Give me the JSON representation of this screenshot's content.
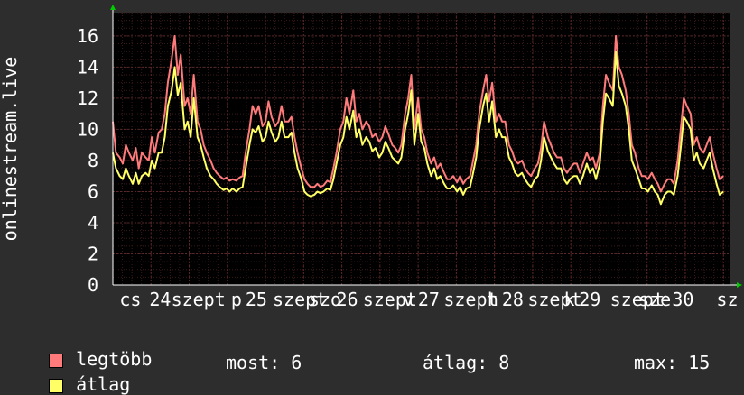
{
  "chart_data": {
    "type": "line",
    "ylabel": "onlinestream.live",
    "ylim": [
      0,
      17.5
    ],
    "yticks": [
      0,
      2,
      4,
      6,
      8,
      10,
      12,
      14,
      16
    ],
    "x_range": [
      0,
      8.08
    ],
    "x_tick_labels": [
      {
        "x": 0.23,
        "label": "cs"
      },
      {
        "x": 0.62,
        "label": "24"
      },
      {
        "x": 1.12,
        "label": "szept"
      },
      {
        "x": 1.62,
        "label": "p"
      },
      {
        "x": 1.88,
        "label": "25"
      },
      {
        "x": 2.45,
        "label": "szept"
      },
      {
        "x": 2.78,
        "label": "szo"
      },
      {
        "x": 3.07,
        "label": "26"
      },
      {
        "x": 3.63,
        "label": "szept"
      },
      {
        "x": 3.87,
        "label": "v"
      },
      {
        "x": 4.14,
        "label": "27"
      },
      {
        "x": 4.69,
        "label": "szept"
      },
      {
        "x": 4.98,
        "label": "h"
      },
      {
        "x": 5.24,
        "label": "28"
      },
      {
        "x": 5.79,
        "label": "szept"
      },
      {
        "x": 5.98,
        "label": "k"
      },
      {
        "x": 6.25,
        "label": "29"
      },
      {
        "x": 6.87,
        "label": "szept"
      },
      {
        "x": 7.1,
        "label": "sze"
      },
      {
        "x": 7.47,
        "label": "30"
      },
      {
        "x": 8.05,
        "label": "sz"
      }
    ],
    "series": [
      {
        "name": "legtöbb",
        "color": "#ff7b7b",
        "x": [
          0,
          0.04,
          0.09,
          0.13,
          0.17,
          0.21,
          0.26,
          0.3,
          0.34,
          0.38,
          0.43,
          0.47,
          0.51,
          0.55,
          0.6,
          0.64,
          0.68,
          0.72,
          0.77,
          0.81,
          0.85,
          0.89,
          0.94,
          0.98,
          1.02,
          1.06,
          1.11,
          1.15,
          1.19,
          1.23,
          1.28,
          1.32,
          1.36,
          1.4,
          1.45,
          1.49,
          1.53,
          1.57,
          1.62,
          1.66,
          1.7,
          1.74,
          1.79,
          1.83,
          1.87,
          1.91,
          1.96,
          2,
          2.04,
          2.08,
          2.13,
          2.17,
          2.21,
          2.25,
          2.3,
          2.34,
          2.38,
          2.42,
          2.47,
          2.51,
          2.55,
          2.59,
          2.64,
          2.68,
          2.72,
          2.76,
          2.81,
          2.85,
          2.89,
          2.93,
          2.98,
          3.02,
          3.06,
          3.1,
          3.15,
          3.19,
          3.23,
          3.27,
          3.32,
          3.36,
          3.4,
          3.44,
          3.49,
          3.53,
          3.57,
          3.61,
          3.66,
          3.7,
          3.74,
          3.78,
          3.83,
          3.87,
          3.91,
          3.95,
          4,
          4.04,
          4.08,
          4.12,
          4.17,
          4.21,
          4.25,
          4.29,
          4.34,
          4.38,
          4.42,
          4.46,
          4.51,
          4.55,
          4.59,
          4.63,
          4.68,
          4.72,
          4.76,
          4.8,
          4.85,
          4.89,
          4.93,
          4.97,
          5.02,
          5.06,
          5.1,
          5.14,
          5.19,
          5.23,
          5.27,
          5.31,
          5.36,
          5.4,
          5.44,
          5.48,
          5.53,
          5.57,
          5.61,
          5.65,
          5.7,
          5.74,
          5.78,
          5.82,
          5.87,
          5.91,
          5.95,
          5.99,
          6.04,
          6.08,
          6.12,
          6.16,
          6.21,
          6.25,
          6.29,
          6.33,
          6.38,
          6.42,
          6.46,
          6.5,
          6.55,
          6.59,
          6.63,
          6.67,
          6.72,
          6.76,
          6.8,
          6.84,
          6.89,
          6.93,
          6.97,
          7.01,
          7.06,
          7.1,
          7.14,
          7.18,
          7.23,
          7.27,
          7.31,
          7.35,
          7.4,
          7.44,
          7.48,
          7.52,
          7.57,
          7.61,
          7.65,
          7.69,
          7.74,
          7.78,
          7.82,
          7.86,
          7.91,
          7.95,
          8
        ],
        "values": [
          10.5,
          8.5,
          8.2,
          7.8,
          9,
          8.5,
          8,
          8.8,
          7.5,
          8.5,
          8.2,
          8,
          9.5,
          8.5,
          9.8,
          10,
          11,
          13,
          14.5,
          16,
          13.5,
          14.8,
          11.5,
          12,
          11,
          13.5,
          10.5,
          10,
          9,
          8.5,
          8,
          7.5,
          7.2,
          7,
          6.8,
          6.9,
          6.7,
          6.8,
          6.7,
          6.9,
          7,
          8.5,
          10,
          11.5,
          11,
          11.5,
          10.2,
          10.5,
          11.8,
          10.8,
          10.2,
          10.5,
          11.5,
          10.5,
          10.5,
          10.8,
          9.5,
          8.5,
          7.5,
          6.8,
          6.5,
          6.3,
          6.3,
          6.5,
          6.3,
          6.4,
          6.7,
          6.6,
          7.5,
          8.5,
          10,
          10.5,
          12,
          11,
          12.5,
          10.5,
          11,
          10,
          10.5,
          10.2,
          9.5,
          9.7,
          9.2,
          9.5,
          10.2,
          9.7,
          9,
          8.8,
          8.5,
          9,
          11,
          12,
          13.5,
          10,
          12,
          10,
          9.5,
          8.5,
          7.8,
          8.2,
          7.5,
          7.8,
          7.2,
          6.8,
          6.8,
          7,
          6.6,
          7,
          6.5,
          6.8,
          7,
          8,
          9,
          11,
          12.5,
          13.5,
          11.8,
          13,
          10.5,
          11,
          10.5,
          10.5,
          9,
          8.6,
          8,
          7.8,
          8,
          7.5,
          7.2,
          7,
          7.5,
          7.8,
          8.8,
          10.5,
          9.5,
          9,
          8.5,
          8.2,
          8.2,
          7.5,
          7.2,
          7.5,
          7.8,
          7.8,
          7.2,
          7.8,
          8.5,
          8,
          8.2,
          7.5,
          8.5,
          11.5,
          13.5,
          13,
          12.5,
          16,
          14,
          13.5,
          12.5,
          11,
          9,
          8.5,
          7.5,
          7,
          7,
          6.8,
          7.2,
          6.8,
          6.5,
          6,
          6.5,
          6.8,
          6.8,
          6.5,
          8,
          10,
          12,
          11.5,
          11,
          9,
          9.5,
          8.8,
          8.5,
          9,
          9.5,
          8.5,
          7.5,
          6.8,
          7
        ]
      },
      {
        "name": "átlag",
        "color": "#ffff66",
        "x": [
          0,
          0.04,
          0.09,
          0.13,
          0.17,
          0.21,
          0.26,
          0.3,
          0.34,
          0.38,
          0.43,
          0.47,
          0.51,
          0.55,
          0.6,
          0.64,
          0.68,
          0.72,
          0.77,
          0.81,
          0.85,
          0.89,
          0.94,
          0.98,
          1.02,
          1.06,
          1.11,
          1.15,
          1.19,
          1.23,
          1.28,
          1.32,
          1.36,
          1.4,
          1.45,
          1.49,
          1.53,
          1.57,
          1.62,
          1.66,
          1.7,
          1.74,
          1.79,
          1.83,
          1.87,
          1.91,
          1.96,
          2,
          2.04,
          2.08,
          2.13,
          2.17,
          2.21,
          2.25,
          2.3,
          2.34,
          2.38,
          2.42,
          2.47,
          2.51,
          2.55,
          2.59,
          2.64,
          2.68,
          2.72,
          2.76,
          2.81,
          2.85,
          2.89,
          2.93,
          2.98,
          3.02,
          3.06,
          3.1,
          3.15,
          3.19,
          3.23,
          3.27,
          3.32,
          3.36,
          3.4,
          3.44,
          3.49,
          3.53,
          3.57,
          3.61,
          3.66,
          3.7,
          3.74,
          3.78,
          3.83,
          3.87,
          3.91,
          3.95,
          4,
          4.04,
          4.08,
          4.12,
          4.17,
          4.21,
          4.25,
          4.29,
          4.34,
          4.38,
          4.42,
          4.46,
          4.51,
          4.55,
          4.59,
          4.63,
          4.68,
          4.72,
          4.76,
          4.8,
          4.85,
          4.89,
          4.93,
          4.97,
          5.02,
          5.06,
          5.1,
          5.14,
          5.19,
          5.23,
          5.27,
          5.31,
          5.36,
          5.4,
          5.44,
          5.48,
          5.53,
          5.57,
          5.61,
          5.65,
          5.7,
          5.74,
          5.78,
          5.82,
          5.87,
          5.91,
          5.95,
          5.99,
          6.04,
          6.08,
          6.12,
          6.16,
          6.21,
          6.25,
          6.29,
          6.33,
          6.38,
          6.42,
          6.46,
          6.5,
          6.55,
          6.59,
          6.63,
          6.67,
          6.72,
          6.76,
          6.8,
          6.84,
          6.89,
          6.93,
          6.97,
          7.01,
          7.06,
          7.1,
          7.14,
          7.18,
          7.23,
          7.27,
          7.31,
          7.35,
          7.4,
          7.44,
          7.48,
          7.52,
          7.57,
          7.61,
          7.65,
          7.69,
          7.74,
          7.78,
          7.82,
          7.86,
          7.91,
          7.95,
          8
        ],
        "values": [
          8.5,
          7.5,
          7,
          6.8,
          7.5,
          7,
          6.5,
          7.2,
          6.5,
          7,
          7.2,
          7,
          8,
          7.5,
          8.5,
          8.5,
          9.5,
          11.5,
          12.5,
          14,
          12.2,
          13,
          10,
          10.5,
          9.5,
          12,
          9.5,
          9,
          8.2,
          7.5,
          7,
          6.8,
          6.5,
          6.3,
          6.1,
          6.2,
          6,
          6.2,
          6,
          6.2,
          6.3,
          7.5,
          9,
          10,
          9.8,
          10.2,
          9.2,
          9.5,
          10.5,
          9.8,
          9.2,
          9.5,
          10.5,
          9.5,
          9.5,
          9.8,
          8.5,
          7.5,
          6.8,
          6,
          5.8,
          5.7,
          5.8,
          6,
          5.9,
          6,
          6.2,
          6.1,
          6.8,
          7.8,
          9,
          9.5,
          10.8,
          10,
          11.2,
          9.5,
          10,
          9,
          9.5,
          9.2,
          8.6,
          8.8,
          8.2,
          8.5,
          9.2,
          8.8,
          8.2,
          8,
          7.8,
          8.2,
          10,
          11,
          12.5,
          9,
          11,
          9.2,
          8.8,
          7.8,
          7,
          7.5,
          6.8,
          7,
          6.5,
          6.2,
          6.2,
          6.4,
          6,
          6.3,
          5.8,
          6.2,
          6.3,
          7.2,
          8.2,
          10,
          11.5,
          12.3,
          10.5,
          11.8,
          9.5,
          10,
          9.5,
          9.5,
          8.2,
          7.8,
          7.2,
          7,
          7.2,
          6.8,
          6.5,
          6.3,
          6.8,
          7,
          8,
          9.5,
          8.6,
          8.2,
          7.8,
          7.5,
          7.5,
          6.8,
          6.5,
          6.8,
          7,
          7,
          6.5,
          7,
          7.8,
          7.2,
          7.5,
          6.8,
          7.8,
          10.5,
          12.3,
          12,
          11.5,
          15,
          12.8,
          12.3,
          11.5,
          10,
          8,
          7.5,
          6.8,
          6.2,
          6.2,
          6,
          6.4,
          6,
          5.8,
          5.2,
          5.8,
          6,
          6,
          5.8,
          7,
          8.8,
          10.8,
          10.5,
          10,
          8,
          8.5,
          7.8,
          7.5,
          8,
          8.5,
          7.5,
          6.5,
          5.8,
          6
        ]
      }
    ],
    "grid": true
  },
  "legend": {
    "max_label": "legtöbb",
    "avg_label": "átlag",
    "max_color": "#ff7b7b",
    "avg_color": "#ffff66"
  },
  "stats": {
    "now": "most: 6",
    "avg": "átlag: 8",
    "max": "max: 15"
  },
  "colors": {
    "background": "#2d2d2d",
    "plot_background": "#000000",
    "major_grid": "#5a2828",
    "minor_grid": "#3a1a1a",
    "axis_arrow": "#00cc00"
  }
}
